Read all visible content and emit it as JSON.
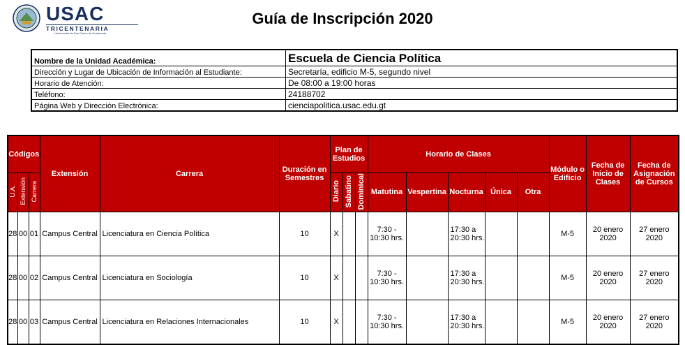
{
  "logo": {
    "name": "USAC",
    "subtitle": "TRICENTENARIA",
    "tagline": "Universidad de San Carlos de Guatemala"
  },
  "page_title": "Guía de Inscripción 2020",
  "info": [
    {
      "label": "Nombre de la Unidad Académica:",
      "value": "Escuela de Ciencia Política"
    },
    {
      "label": "Dirección y Lugar de Ubicación de Información al Estudiante:",
      "value": "Secretaría, edificio M-5, segundo nivel"
    },
    {
      "label": "Horario de Atención:",
      "value": "De 08:00 a 19:00 horas"
    },
    {
      "label": "Teléfono:",
      "value": "24188702"
    },
    {
      "label": "Página Web y Dirección Electrónica:",
      "value": "cienciapolitica.usac.edu.gt"
    }
  ],
  "headers": {
    "codigos": "Códigos",
    "ua": "U.A.",
    "extension_code": "Extensión",
    "carrera_code": "Carrera",
    "extension": "Extensión",
    "carrera": "Carrera",
    "duracion": "Duración en Semestres",
    "plan": "Plan de Estudios",
    "diario": "Diario",
    "sabatino": "Sabatino",
    "dominical": "Dominical",
    "horario": "Horario de Clases",
    "matutina": "Matutina",
    "vespertina": "Vespertina",
    "nocturna": "Nocturna",
    "unica": "Única",
    "otra": "Otra",
    "modulo": "Módulo o Edificio",
    "inicio": "Fecha de Inicio de Clases",
    "asignacion": "Fecha de Asignación de Cursos"
  },
  "rows": [
    {
      "ua": "28",
      "ext": "00",
      "car": "01",
      "extension": "Campus Central",
      "carrera": "Licenciatura en Ciencia Política",
      "duracion": "10",
      "diario": "X",
      "sabatino": "",
      "dominical": "",
      "matutina": "7:30 - 10:30 hrs.",
      "vespertina": "",
      "nocturna": "17:30 a 20:30 hrs.",
      "unica": "",
      "otra": "",
      "modulo": "M-5",
      "inicio": "20 enero 2020",
      "asignacion": "27 enero 2020"
    },
    {
      "ua": "28",
      "ext": "00",
      "car": "02",
      "extension": "Campus Central",
      "carrera": "Licenciatura en Sociología",
      "duracion": "10",
      "diario": "X",
      "sabatino": "",
      "dominical": "",
      "matutina": "7:30 - 10:30 hrs.",
      "vespertina": "",
      "nocturna": "17:30 a 20:30 hrs.",
      "unica": "",
      "otra": "",
      "modulo": "M-5",
      "inicio": "20 enero 2020",
      "asignacion": "27 enero 2020"
    },
    {
      "ua": "28",
      "ext": "00",
      "car": "03",
      "extension": "Campus Central",
      "carrera": "Licenciatura en Relaciones Internacionales",
      "duracion": "10",
      "diario": "X",
      "sabatino": "",
      "dominical": "",
      "matutina": "7:30 - 10:30 hrs.",
      "vespertina": "",
      "nocturna": "17:30 a 20:30 hrs.",
      "unica": "",
      "otra": "",
      "modulo": "M-5",
      "inicio": "20 enero 2020",
      "asignacion": "27 enero 2020"
    }
  ]
}
